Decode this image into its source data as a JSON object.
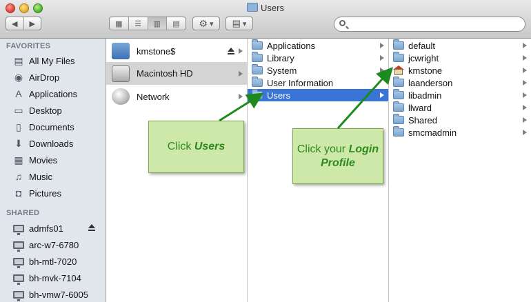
{
  "window": {
    "title": "Users"
  },
  "toolbar": {
    "back_label": "◀",
    "forward_label": "▶",
    "view_icon_glyph": "▦",
    "view_list_glyph": "☰",
    "view_column_glyph": "▥",
    "view_coverflow_glyph": "▤",
    "action_glyph": "⚙",
    "arrange_glyph": "▤",
    "dropdown_glyph": "▾",
    "search_placeholder": ""
  },
  "sidebar": {
    "favorites_header": "FAVORITES",
    "favorites": [
      {
        "label": "All My Files",
        "icon": "all-files-icon",
        "glyph": "▤"
      },
      {
        "label": "AirDrop",
        "icon": "airdrop-icon",
        "glyph": "◉"
      },
      {
        "label": "Applications",
        "icon": "applications-icon",
        "glyph": "A"
      },
      {
        "label": "Desktop",
        "icon": "desktop-icon",
        "glyph": "▭"
      },
      {
        "label": "Documents",
        "icon": "documents-icon",
        "glyph": "▯"
      },
      {
        "label": "Downloads",
        "icon": "downloads-icon",
        "glyph": "⬇"
      },
      {
        "label": "Movies",
        "icon": "movies-icon",
        "glyph": "▦"
      },
      {
        "label": "Music",
        "icon": "music-icon",
        "glyph": "♫"
      },
      {
        "label": "Pictures",
        "icon": "pictures-icon",
        "glyph": "◘"
      }
    ],
    "shared_header": "SHARED",
    "shared": [
      {
        "label": "admfs01",
        "eject": true
      },
      {
        "label": "arc-w7-6780"
      },
      {
        "label": "bh-mtl-7020"
      },
      {
        "label": "bh-mvk-7104"
      },
      {
        "label": "bh-vmw7-6005"
      }
    ]
  },
  "columns": {
    "devices": [
      {
        "label": "kmstone$",
        "icon": "network-share-icon",
        "eject": true
      },
      {
        "label": "Macintosh HD",
        "icon": "hard-drive-icon",
        "selected": true
      },
      {
        "label": "Network",
        "icon": "network-icon"
      }
    ],
    "root": [
      {
        "label": "Applications"
      },
      {
        "label": "Library"
      },
      {
        "label": "System"
      },
      {
        "label": "User Information",
        "noarrow": true
      },
      {
        "label": "Users",
        "selected": true
      }
    ],
    "users": [
      {
        "label": "default"
      },
      {
        "label": "jcwright"
      },
      {
        "label": "kmstone",
        "home": true
      },
      {
        "label": "laanderson"
      },
      {
        "label": "libadmin"
      },
      {
        "label": "llward"
      },
      {
        "label": "Shared"
      },
      {
        "label": "smcmadmin"
      }
    ]
  },
  "callouts": {
    "users": {
      "prefix": "Click ",
      "emphasis": "Users"
    },
    "login": {
      "prefix": "Click your ",
      "emphasis": "Login Profile"
    }
  },
  "colors": {
    "selection": "#3875d7",
    "callout_bg": "#cde8a8",
    "callout_text": "#2d8a1e",
    "arrow": "#1e8a1e"
  }
}
